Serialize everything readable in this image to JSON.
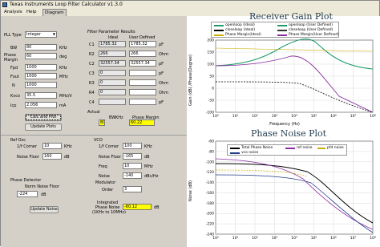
{
  "window": {
    "title": "Texas Instruments Loop Filter Calculator v1.3.0"
  },
  "menu": {
    "items": [
      "Analysis",
      "Help",
      "Diagram"
    ]
  },
  "pll": {
    "type_label": "PLL Type",
    "type_value": "Integer",
    "params": [
      {
        "label": "BW",
        "value": "80",
        "unit": "KHz"
      },
      {
        "label": "Phase Margin",
        "value": "60",
        "unit": "deg"
      },
      {
        "label": "Fpd",
        "value": "1000",
        "unit": "KHz"
      },
      {
        "label": "Fout",
        "value": "1000",
        "unit": "MHz"
      },
      {
        "label": "N",
        "value": "1000",
        "unit": ""
      },
      {
        "label": "Kvco",
        "value": "35.5",
        "unit": "MHz/V"
      },
      {
        "label": "Icp",
        "value": "2.056",
        "unit": "mA"
      }
    ],
    "calc_button": "Calc and Plot",
    "update_plots_button": "Update Plots"
  },
  "filter": {
    "title": "Filter Parameter Results",
    "col_ideal": "Ideal",
    "col_user": "User Defined",
    "rows": [
      {
        "label": "C1",
        "ideal": "1785.32",
        "user": "1785.32",
        "unit": "pF"
      },
      {
        "label": "R2",
        "ideal": "266",
        "user": "266",
        "unit": "Ohm"
      },
      {
        "label": "C2",
        "ideal": "32557.34",
        "user": "32557.34",
        "unit": "pF"
      },
      {
        "label": "C3",
        "ideal": "0",
        "user": "",
        "unit": "pF"
      },
      {
        "label": "R3",
        "ideal": "0",
        "user": "",
        "unit": "Ohm"
      },
      {
        "label": "R4",
        "ideal": "0",
        "user": "",
        "unit": "Ohm"
      },
      {
        "label": "C4",
        "ideal": "",
        "user": "",
        "unit": "pF"
      }
    ],
    "actual_label": "Actual",
    "bw_label": "BW",
    "bw_unit": "KHz",
    "bw_value": "80",
    "pm_label": "Phase Margin",
    "pm_value": "60.22"
  },
  "ref": {
    "title": "Ref Osc",
    "corner_label": "1/f Corner",
    "corner_value": "10",
    "corner_unit": "KHz",
    "nf_label": "Noise Floor",
    "nf_value": "160",
    "nf_unit": "dB"
  },
  "vco": {
    "title": "VCO",
    "corner_label": "1/f Corner",
    "corner_value": "100",
    "corner_unit": "KHz",
    "nf_label": "Noise Floor",
    "nf_value": "-165",
    "nf_unit": "dB",
    "freq_label": "Freq",
    "freq_value": "10",
    "freq_unit": "MHz",
    "noise_label": "Noise",
    "noise_value": "-140",
    "noise_unit": "dBc/Hz"
  },
  "pd": {
    "title": "Phase Detector",
    "nf_label": "Norm Noise Floor",
    "nf_value": "-224",
    "nf_unit": "dB"
  },
  "modulator": {
    "title": "Modulator",
    "order_label": "Order",
    "order_value": "3"
  },
  "update_noise_button": "Update Noise",
  "integrated": {
    "label_line1": "Integrated",
    "label_line2": "Phase Noise",
    "label_line3": "(1KHz to 10MHz)",
    "value": "-60.12",
    "unit": "dB"
  },
  "gain_plot": {
    "title": "Receiver Gain Plot",
    "xlabel": "Frequency (Hz)",
    "ylabel": "Gain (dB) /Phase(Degree)",
    "legend": [
      {
        "name": "openloop (Ideal)",
        "color": "#1f9c6a",
        "dashed": false
      },
      {
        "name": "closeloop (Ideal)",
        "color": "#000000",
        "dashed": true
      },
      {
        "name": "Phase Margin(Ideal)",
        "color": "#c9b000",
        "dashed": false
      },
      {
        "name": "openloop (User Defined)",
        "color": "#1f9c6a",
        "dashed": false
      },
      {
        "name": "closeloop (User Defined)",
        "color": "#333333",
        "dashed": true
      },
      {
        "name": "Phase Margin(User Defined)",
        "color": "#8a2da0",
        "dashed": true
      }
    ],
    "y_ticks": [
      "200",
      "150",
      "100",
      "50",
      "0",
      "-50",
      "-100"
    ],
    "x_ticks": [
      "10⁰",
      "10¹",
      "10²",
      "10³",
      "10⁴",
      "10⁵",
      "10⁶",
      "10⁷",
      "10⁸"
    ]
  },
  "noise_plot": {
    "title": "Phase Noise Plot",
    "xlabel": "Frequency (Hz)",
    "ylabel": "Noise (dB)",
    "legend": [
      {
        "name": "Total Phase Noise",
        "color": "#000000",
        "dashed": false
      },
      {
        "name": "ref noise",
        "color": "#8a2da0",
        "dashed": false
      },
      {
        "name": "pfd noise",
        "color": "#c9b000",
        "dashed": true
      },
      {
        "name": "vco noise",
        "color": "#1f3b8a",
        "dashed": false
      }
    ],
    "y_ticks": [
      "-60",
      "-80",
      "-100",
      "-120",
      "-140",
      "-160",
      "-180",
      "-200",
      "-220",
      "-240"
    ],
    "x_ticks": [
      "10⁰",
      "10¹",
      "10²",
      "10³",
      "10⁴",
      "10⁵",
      "10⁶",
      "10⁷",
      "10⁸"
    ]
  }
}
